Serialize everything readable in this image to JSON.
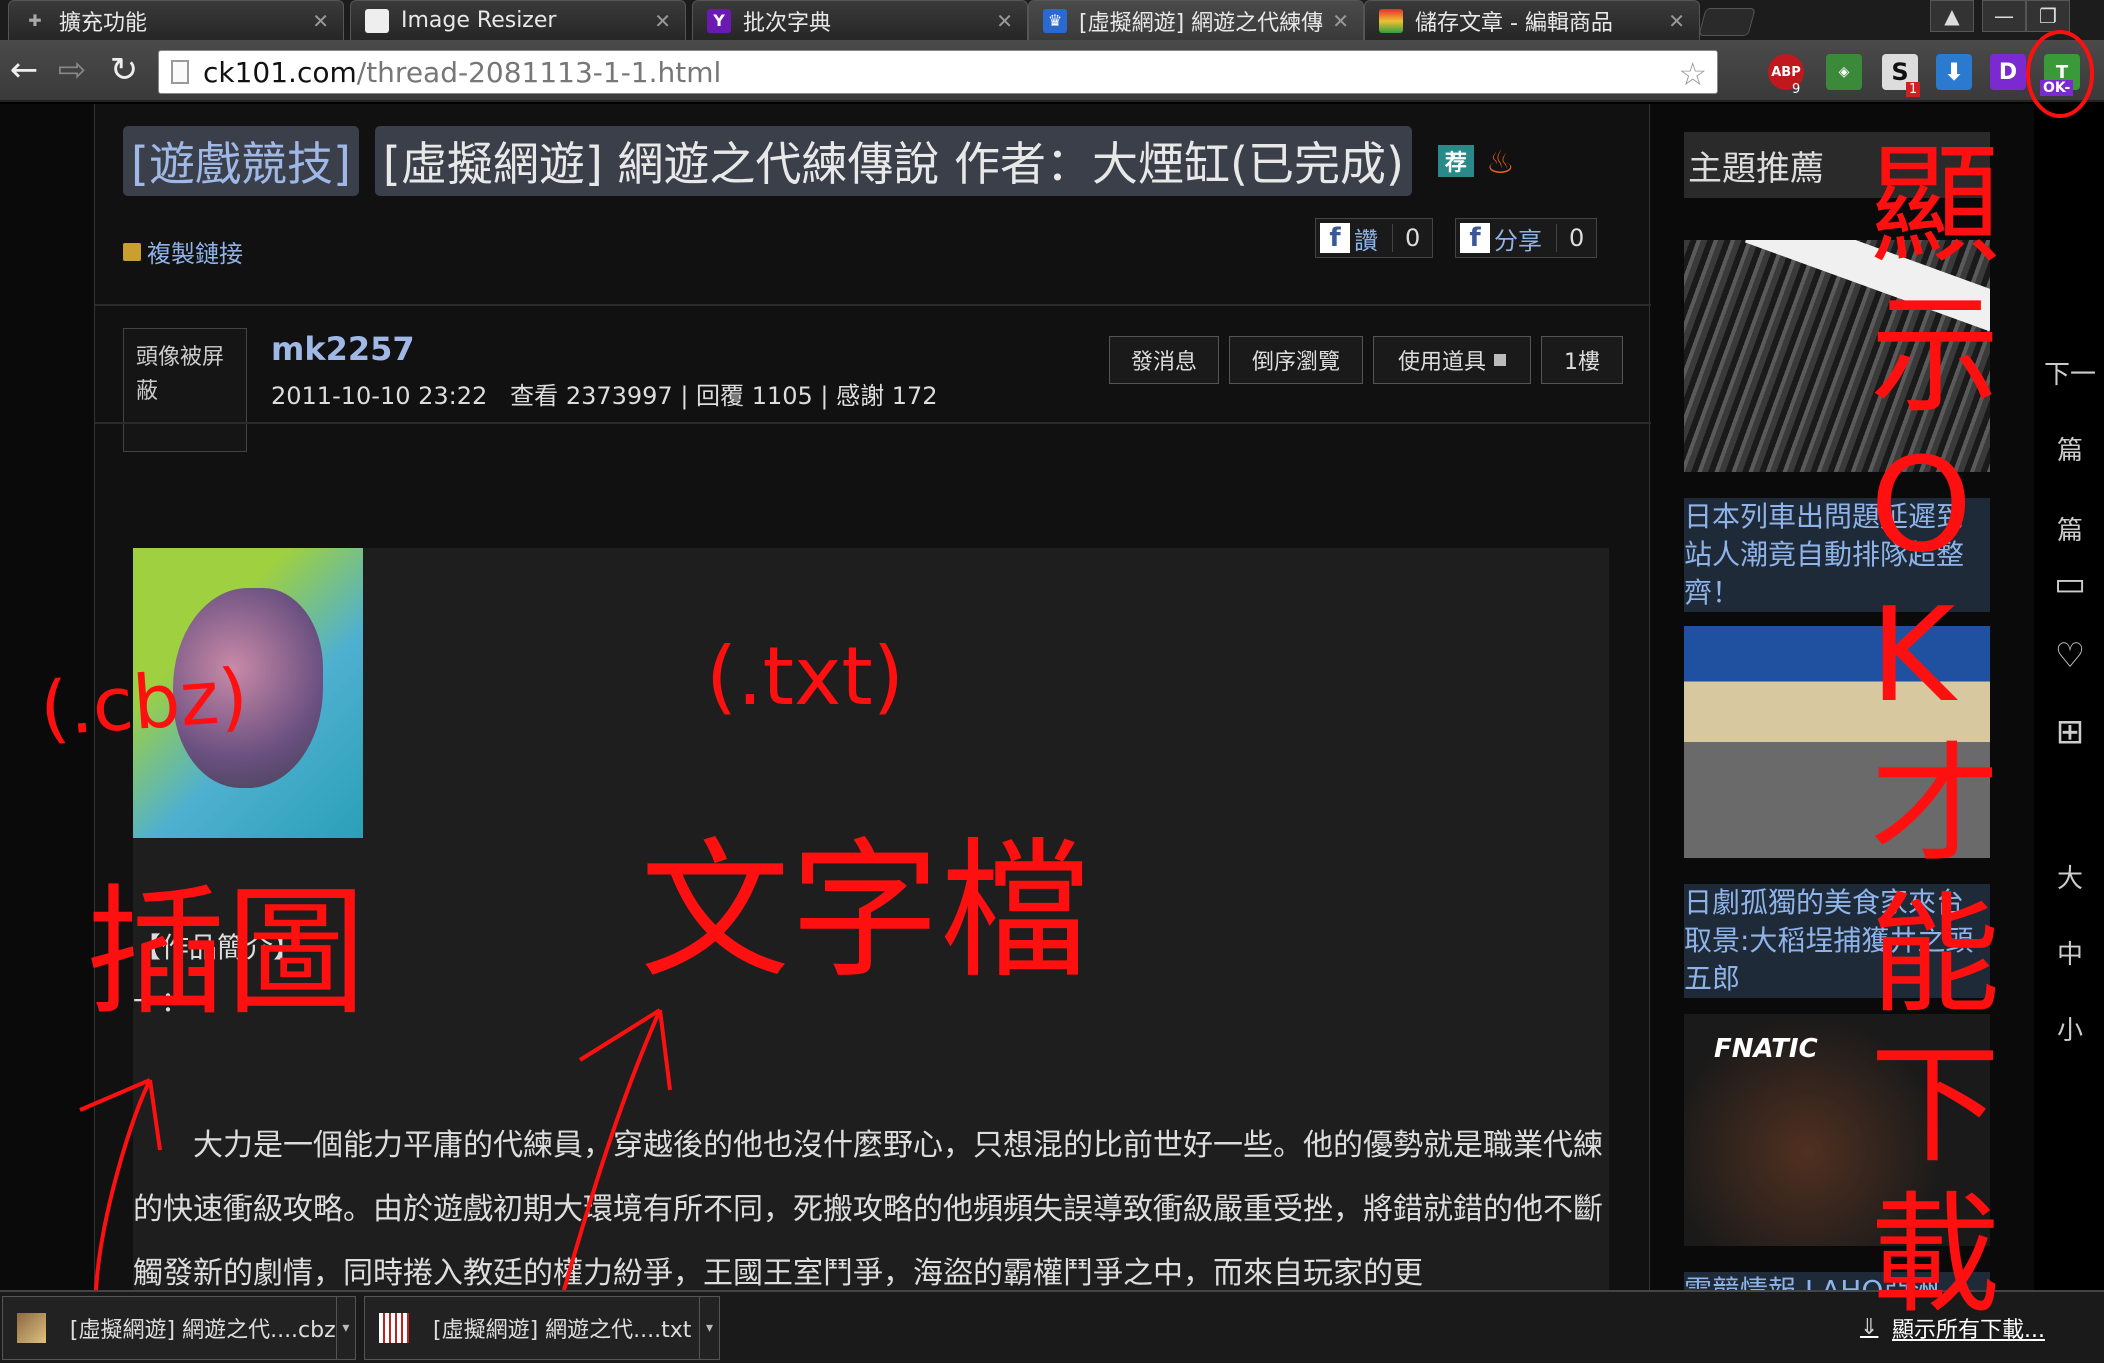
{
  "tabs": [
    {
      "label": "擴充功能",
      "icon": "puzzle-icon"
    },
    {
      "label": "Image Resizer",
      "icon": "doc-icon"
    },
    {
      "label": "批次字典",
      "icon": "yahoo-icon",
      "glyph": "Y"
    },
    {
      "label": "[虛擬網遊] 網遊之代練傳說",
      "icon": "crown-icon",
      "active": true
    },
    {
      "label": "儲存文章 - 編輯商品",
      "icon": "rainbow-icon"
    }
  ],
  "window_controls": {
    "user": "▲",
    "minimize": "—",
    "restore": "❐"
  },
  "toolbar": {
    "back": "←",
    "forward": "⇨",
    "reload": "↻",
    "url_host": "ck101.com",
    "url_path": "/thread-2081113-1-1.html",
    "star": "☆",
    "extensions": [
      {
        "name": "abp-icon",
        "label": "ABP",
        "badge": "9",
        "color": "#c0181c"
      },
      {
        "name": "ext-gift-icon",
        "label": "◈",
        "badge": "",
        "color": "#3a8a3a"
      },
      {
        "name": "ext-s-icon",
        "label": "S",
        "badge": "1",
        "color": "#333333"
      },
      {
        "name": "download-ext-icon",
        "label": "⬇",
        "badge": "",
        "color": "#2a7ad0"
      },
      {
        "name": "ext-d-icon",
        "label": "D",
        "badge": "",
        "color": "#7a2ad0"
      },
      {
        "name": "ext-ok-icon",
        "label": "T",
        "badge": "OK-",
        "color": "#3a9a3a"
      }
    ]
  },
  "thread": {
    "category": "[遊戲競技]",
    "title": "[虛擬網遊] 網遊之代練傳說 作者：大煙缸(已完成)",
    "badge_recommend": "荐",
    "copy_link": "複製鏈接",
    "like_label": "讚",
    "like_count": "0",
    "share_label": "分享",
    "share_count": "0"
  },
  "post": {
    "avatar_text": "頭像被屏蔽",
    "author": "mk2257",
    "datetime": "2011-10-10 23:22",
    "views_label": "查看",
    "views": "2373997",
    "replies_label": "回覆",
    "replies": "1105",
    "thanks_label": "感謝",
    "thanks": "172",
    "actions": [
      "發消息",
      "倒序瀏覽",
      "使用道具",
      "1樓"
    ],
    "intro_heading": "【作品簡介】",
    "intro_dash": "一：",
    "body": "大力是一個能力平庸的代練員，穿越後的他也沒什麼野心，只想混的比前世好一些。他的優勢就是職業代練的快速衝級攻略。由於遊戲初期大環境有所不同，死搬攻略的他頻頻失誤導致衝級嚴重受挫，將錯就錯的他不斷觸發新的劇情，同時捲入教廷的權力紛爭，王國王室鬥爭，海盜的霸權鬥爭之中，而來自玩家的更"
  },
  "sidebar": {
    "title": "主題推薦",
    "items": [
      {
        "caption": "日本列車出問題延遲到站人潮竟自動排隊超整齊！"
      },
      {
        "caption": "日劇孤獨的美食家來台取景:大稻埕捕獲井之頭五郎"
      },
      {
        "caption": "電競情報 LAHQ亞洲",
        "overlay": "FNATIC"
      }
    ]
  },
  "right_rail": [
    "下一",
    "篇",
    "篇",
    "大",
    "中",
    "小"
  ],
  "downloads": {
    "items": [
      {
        "label": "[虛擬網遊] 網遊之代....cbz"
      },
      {
        "label": "[虛擬網遊] 網遊之代....txt"
      }
    ],
    "show_all": "顯示所有下載..."
  },
  "annotations": {
    "cbz": "(.cbz)",
    "illustration": "插圖",
    "txt": "(.txt)",
    "text_file": "文字檔",
    "side_note": "顯示OK才能下載"
  }
}
